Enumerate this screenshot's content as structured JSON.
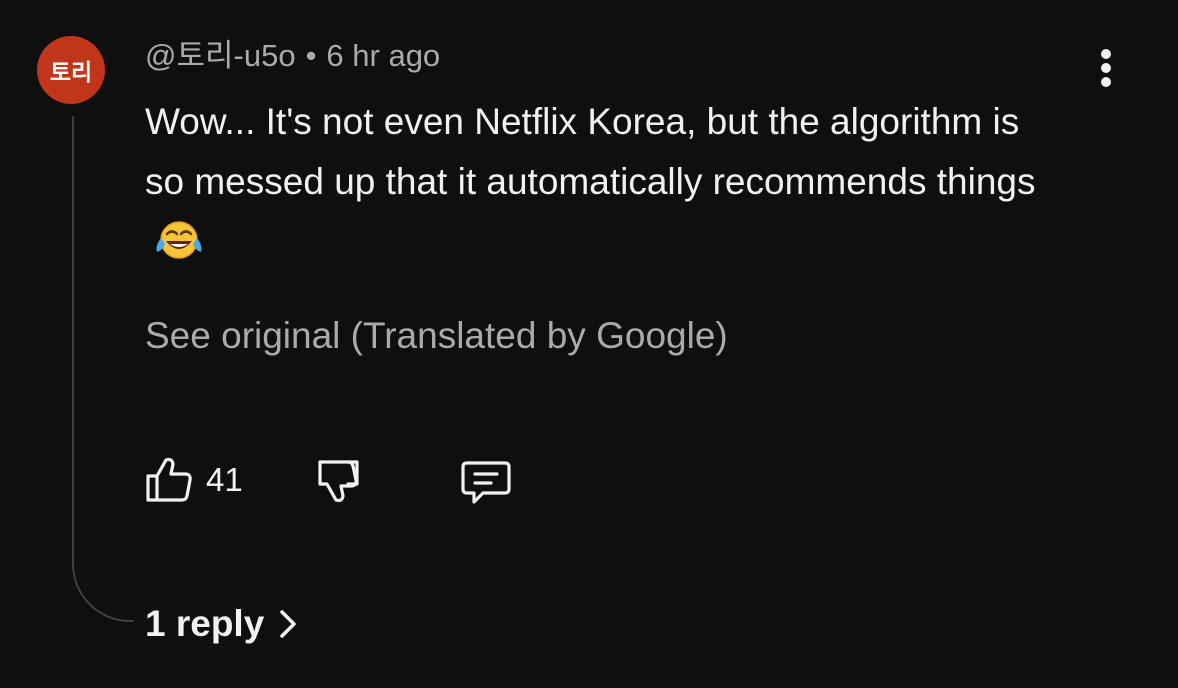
{
  "comment": {
    "avatar_text": "토리",
    "author": "@토리-u5o",
    "separator": "•",
    "timestamp": "6 hr ago",
    "text": "Wow... It's not even Netflix Korea, but the algorithm is so messed up that it automatically recommends things",
    "translation_link": "See original (Translated by Google)",
    "like_count": "41",
    "replies_label": "1 reply"
  },
  "icons": {
    "avatar_color": "#c1361a",
    "more": "more-vertical-icon",
    "emoji": "face-with-tears-of-joy-emoji",
    "like": "thumb-up-icon",
    "dislike": "thumb-down-icon",
    "reply": "comment-bubble-icon",
    "chevron": "chevron-right-icon"
  }
}
